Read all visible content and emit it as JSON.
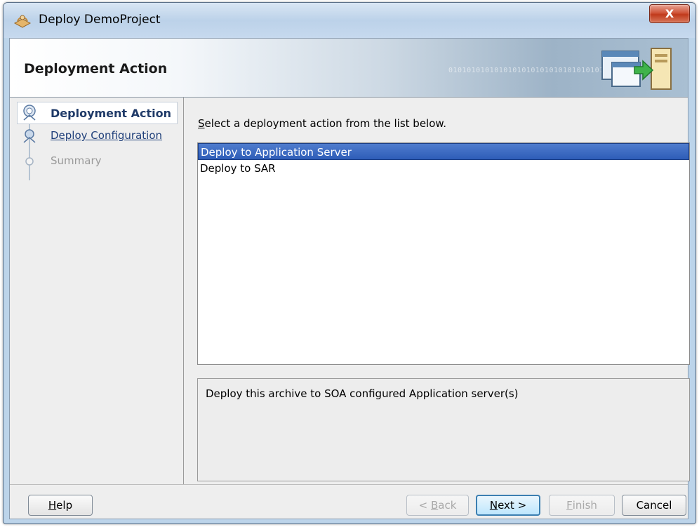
{
  "window": {
    "title": "Deploy DemoProject",
    "close_glyph": "X"
  },
  "header": {
    "title": "Deployment Action",
    "binary_text": "01010101010101010101010101010101010101"
  },
  "train": {
    "steps": [
      {
        "label": "Deployment Action",
        "state": "active"
      },
      {
        "label": "Deploy Configuration",
        "state": "link"
      },
      {
        "label": "Summary",
        "state": "disabled"
      }
    ]
  },
  "main": {
    "prompt_first": "S",
    "prompt_rest": "elect a deployment action from the list below.",
    "actions": [
      {
        "label": "Deploy to Application Server",
        "selected": true
      },
      {
        "label": "Deploy to SAR",
        "selected": false
      }
    ],
    "description": "Deploy this archive to SOA configured Application server(s)"
  },
  "footer": {
    "help": {
      "mnemonic": "H",
      "rest": "elp"
    },
    "back": {
      "prefix": "< ",
      "mnemonic": "B",
      "rest": "ack"
    },
    "next": {
      "mnemonic": "N",
      "rest": "ext >"
    },
    "finish": {
      "mnemonic": "F",
      "rest": "inish"
    },
    "cancel": "Cancel"
  },
  "colors": {
    "selection": "#2e5db8",
    "title_bar": "#bcd2e9",
    "close_button": "#c03a1c",
    "active_step_text": "#1f3a68"
  },
  "icons": [
    "app-icon",
    "close-icon",
    "deploy-graphic",
    "train-active-icon",
    "train-link-icon",
    "train-disabled-icon"
  ]
}
